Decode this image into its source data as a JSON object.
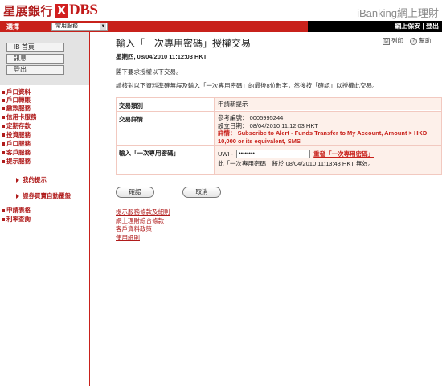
{
  "header": {
    "logo_cn": "星展銀行",
    "logo_x": "X",
    "logo_dbs": "DBS",
    "product": "iBanking網上理財"
  },
  "topnav": {
    "select_label": "選擇",
    "service_select": "常用服務 ...",
    "secure_logout": "網上保安 | 登出"
  },
  "sidebar": {
    "buttons": [
      "IB 首頁",
      "訊息",
      "登出"
    ],
    "menu": [
      "戶口資料",
      "戶口轉賬",
      "繳款服務",
      "信用卡服務",
      "定期存款",
      "投資服務",
      "戶口服務",
      "客戶服務",
      "提示服務"
    ],
    "submenu": [
      "我的提示",
      "證券買賣自動覆盤"
    ],
    "menu_bottom": [
      "申請表格",
      "利率查詢"
    ]
  },
  "main": {
    "title": "輸入「一次專用密碼」授權交易",
    "print": "列印",
    "help": "幫助",
    "datetime": "星期四, 08/04/2010 11:12:03 HKT",
    "intro1": "閣下要求授權以下交易。",
    "intro2": "請核對以下資料準確無誤及輸入「一次專用密碼」的最後8位數字，然後按「確認」以授權此交易。",
    "txn": {
      "type_label": "交易類別",
      "type_value": "申請新提示",
      "detail_label": "交易詳情",
      "ref_line": "參考編號： 0005995244",
      "date_line": "設立日期： 08/04/2010 11:12:03 HKT",
      "detail_prefix": "詳情：",
      "detail_text": "Subscribe to Alert - Funds Transfer to My Account, Amount > HKD 10,000 or its equivalent, SMS",
      "otp_label": "輸入「一次專用密碼」",
      "otp_prefix": "UWI -",
      "otp_value": "••••••••",
      "resend": "重發「一次專用密碼」",
      "expiry": "此「一次專用密碼」將於 08/04/2010 11:13:43 HKT 無效。"
    },
    "confirm": "確認",
    "cancel": "取消",
    "links": [
      "提示服務條款及細則",
      "網上理財綜合條款",
      "客戶資料政策",
      "使用細則"
    ]
  }
}
